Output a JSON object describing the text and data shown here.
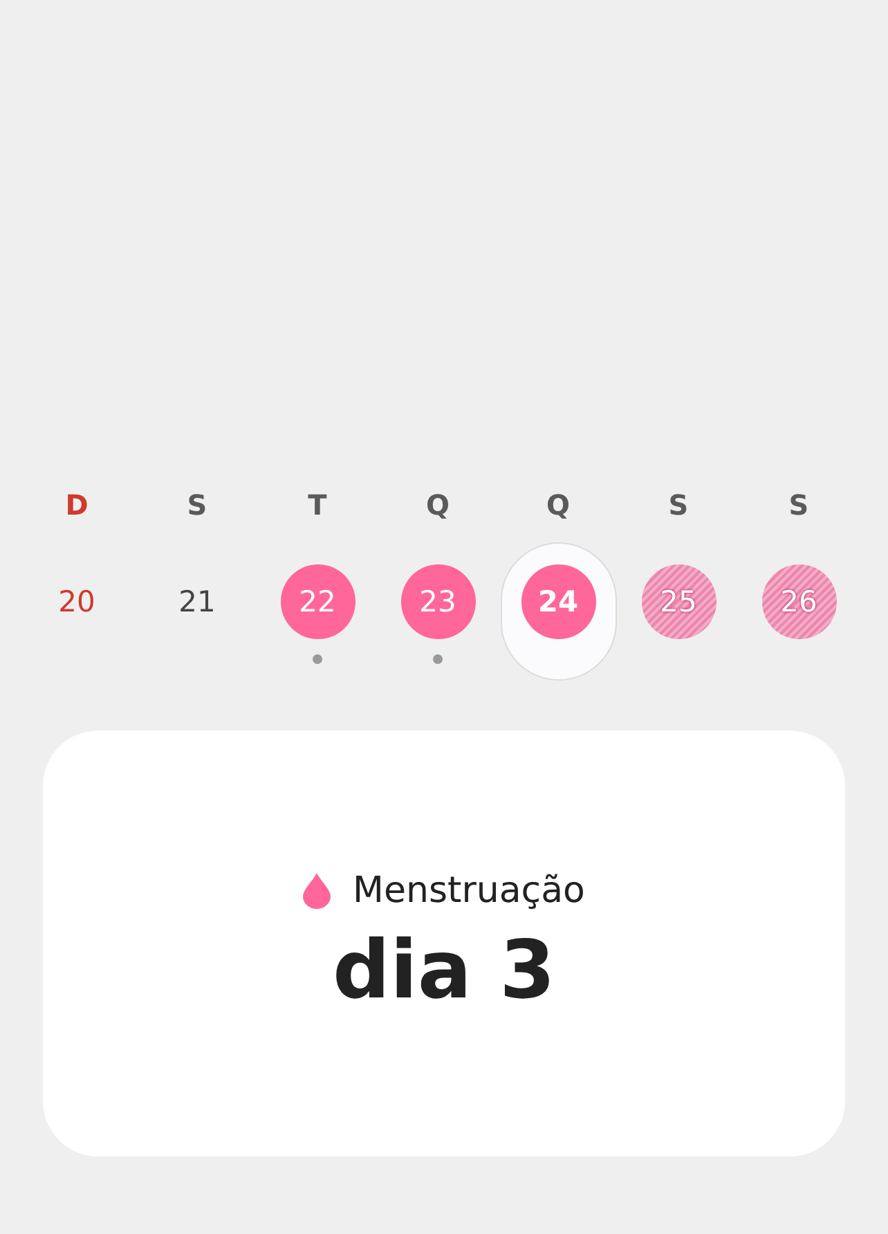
{
  "weekdays": [
    {
      "label": "D",
      "kind": "sunday"
    },
    {
      "label": "S",
      "kind": "weekday"
    },
    {
      "label": "T",
      "kind": "weekday"
    },
    {
      "label": "Q",
      "kind": "weekday"
    },
    {
      "label": "Q",
      "kind": "weekday"
    },
    {
      "label": "S",
      "kind": "weekday"
    },
    {
      "label": "S",
      "kind": "weekday"
    }
  ],
  "days": [
    {
      "label": "20",
      "kind": "sunday",
      "selected": false,
      "marked": false
    },
    {
      "label": "21",
      "kind": "plain",
      "selected": false,
      "marked": false
    },
    {
      "label": "22",
      "kind": "period",
      "selected": false,
      "marked": true
    },
    {
      "label": "23",
      "kind": "period",
      "selected": false,
      "marked": true
    },
    {
      "label": "24",
      "kind": "period",
      "selected": true,
      "marked": false
    },
    {
      "label": "25",
      "kind": "predicted",
      "selected": false,
      "marked": false
    },
    {
      "label": "26",
      "kind": "predicted",
      "selected": false,
      "marked": false
    }
  ],
  "card": {
    "label": "Menstruação",
    "value": "dia 3"
  }
}
